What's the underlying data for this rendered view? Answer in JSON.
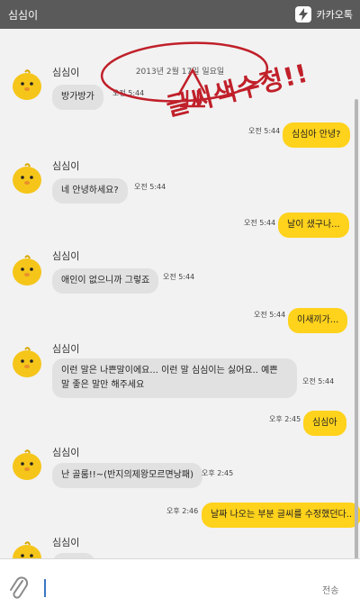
{
  "header": {
    "title": "심심이",
    "brand_label": "카카오톡"
  },
  "date_divider": "2013년 2월 17일 일요일",
  "annotation": {
    "text": "글씨색수정!!",
    "color": "#c0202a"
  },
  "messages": [
    {
      "side": "in",
      "name": "심심이",
      "text": "방가방가",
      "time": "오전 5:44"
    },
    {
      "side": "out",
      "text": "심심아 안녕?",
      "time": "오전 5:44"
    },
    {
      "side": "in",
      "name": "심심이",
      "text": "네 안녕하세요?",
      "time": "오전 5:44"
    },
    {
      "side": "out",
      "text": "날이 샜구나...",
      "time": "오전 5:44"
    },
    {
      "side": "in",
      "name": "심심이",
      "text": "애인이 없으니까 그렇죠",
      "time": "오전 5:44"
    },
    {
      "side": "out",
      "text": "이새끼가...",
      "time": "오전 5:44"
    },
    {
      "side": "in",
      "name": "심심이",
      "text": "이런 말은 나쁜말이에요... 이런 말 심심이는 싫어요.. 예쁜 말 좋은 말만 해주세요",
      "time": "오전 5:44"
    },
    {
      "side": "out",
      "text": "심심아",
      "time": "오후 2:45"
    },
    {
      "side": "in",
      "name": "심심이",
      "text": "난 골룸!!~(반지의제왕모르면낭패)",
      "time": "오후 2:45"
    },
    {
      "side": "out",
      "text": "날짜 나오는 부분 글씨를 수정했던다..",
      "time": "오후 2:46"
    },
    {
      "side": "in",
      "name": "심심이",
      "text": "",
      "time": ""
    }
  ],
  "input": {
    "send_label": "전송"
  },
  "colors": {
    "header_bg": "#5a5a5a",
    "out_bubble": "#ffd21c",
    "in_bubble": "#e1e1e1",
    "chat_bg": "#f2f2f2"
  },
  "icons": {
    "brand": "kakao-lightning-icon",
    "attach": "paperclip-icon",
    "avatar": "yellow-chick-icon"
  }
}
